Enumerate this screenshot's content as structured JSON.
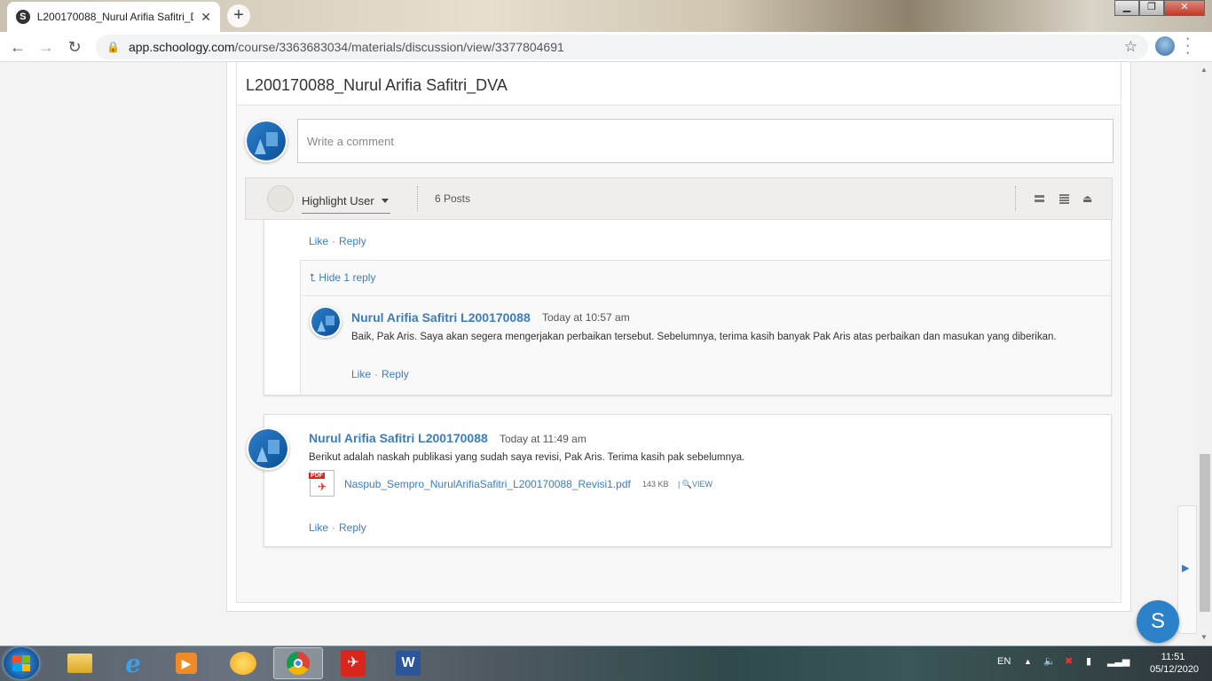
{
  "browser": {
    "tab_title": "L200170088_Nurul Arifia Safitri_D",
    "favicon_letter": "S",
    "tab_close": "✕",
    "new_tab": "+",
    "url_domain": "app.schoology.com",
    "url_path": "/course/3363683034/materials/discussion/view/3377804691",
    "back": "←",
    "forward": "→",
    "reload": "↻",
    "star": "☆",
    "window_buttons": {
      "minimize": "▁",
      "maximize": "❐",
      "close": "✕"
    }
  },
  "page": {
    "title": "L200170088_Nurul Arifia Safitri_DVA",
    "comment_placeholder": "Write a comment"
  },
  "toolbar": {
    "highlight_user": "Highlight User",
    "posts_count": "6 Posts"
  },
  "thread": {
    "top_actions": {
      "like": "Like",
      "reply": "Reply",
      "separator": "·"
    },
    "hide_replies": "Hide 1 reply",
    "reply": {
      "author": "Nurul Arifia Safitri L200170088",
      "time": "Today at 10:57 am",
      "message": "Baik, Pak Aris. Saya akan segera mengerjakan perbaikan tersebut. Sebelumnya, terima kasih banyak Pak Aris atas perbaikan dan masukan yang diberikan.",
      "like": "Like",
      "reply": "Reply"
    }
  },
  "post": {
    "author": "Nurul Arifia Safitri L200170088",
    "time": "Today at 11:49 am",
    "message": "Berikut adalah naskah publikasi yang sudah saya revisi, Pak Aris. Terima kasih pak sebelumnya.",
    "attachment": {
      "icon_label": "PDF",
      "filename": "Naspub_Sempro_NurulArifiaSafitri_L200170088_Revisi1.pdf",
      "size": "143 KB",
      "view": "VIEW"
    },
    "like": "Like",
    "reply": "Reply"
  },
  "fab_letter": "S",
  "taskbar": {
    "language": "EN",
    "time": "11:51",
    "date": "05/12/2020"
  }
}
